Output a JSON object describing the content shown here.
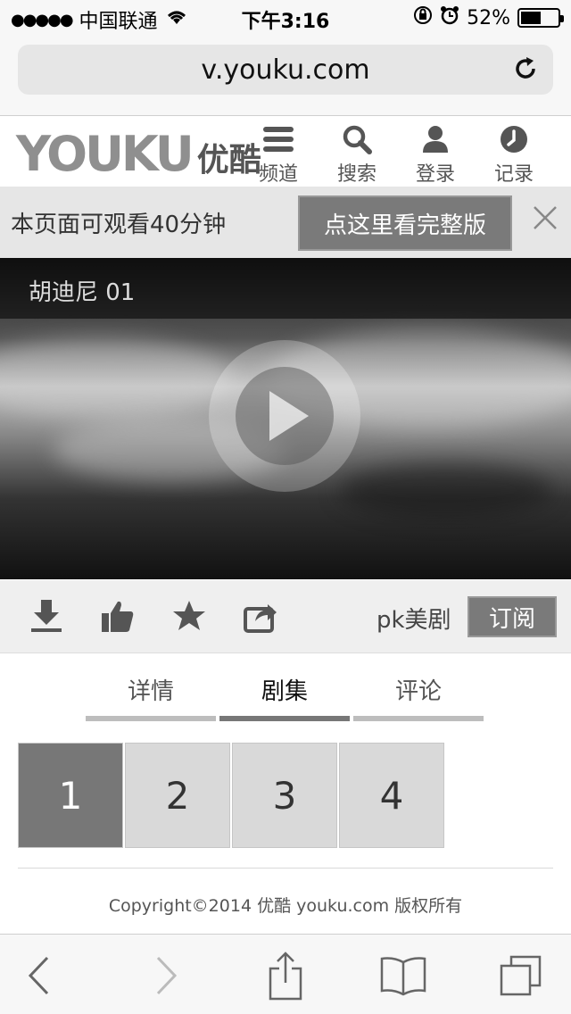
{
  "status_bar": {
    "carrier": "中国联通",
    "time": "下午3:16",
    "battery": "52%"
  },
  "browser": {
    "url": "v.youku.com"
  },
  "header": {
    "logo_en": "YOUKU",
    "logo_cn": "优酷",
    "nav": [
      {
        "label": "频道",
        "icon": "menu-icon"
      },
      {
        "label": "搜索",
        "icon": "search-icon"
      },
      {
        "label": "登录",
        "icon": "user-icon"
      },
      {
        "label": "记录",
        "icon": "clock-icon"
      }
    ]
  },
  "banner": {
    "text": "本页面可观看40分钟",
    "button": "点这里看完整版"
  },
  "video": {
    "title": "胡迪尼 01"
  },
  "actions": {
    "icons": [
      "download-icon",
      "thumbs-up-icon",
      "star-icon",
      "share-icon"
    ],
    "channel": "pk美剧",
    "subscribe": "订阅"
  },
  "tabs": [
    {
      "label": "详情"
    },
    {
      "label": "剧集"
    },
    {
      "label": "评论"
    }
  ],
  "episodes": [
    "1",
    "2",
    "3",
    "4"
  ],
  "footer": {
    "copyright": "Copyright©2014 优酷 youku.com 版权所有"
  }
}
